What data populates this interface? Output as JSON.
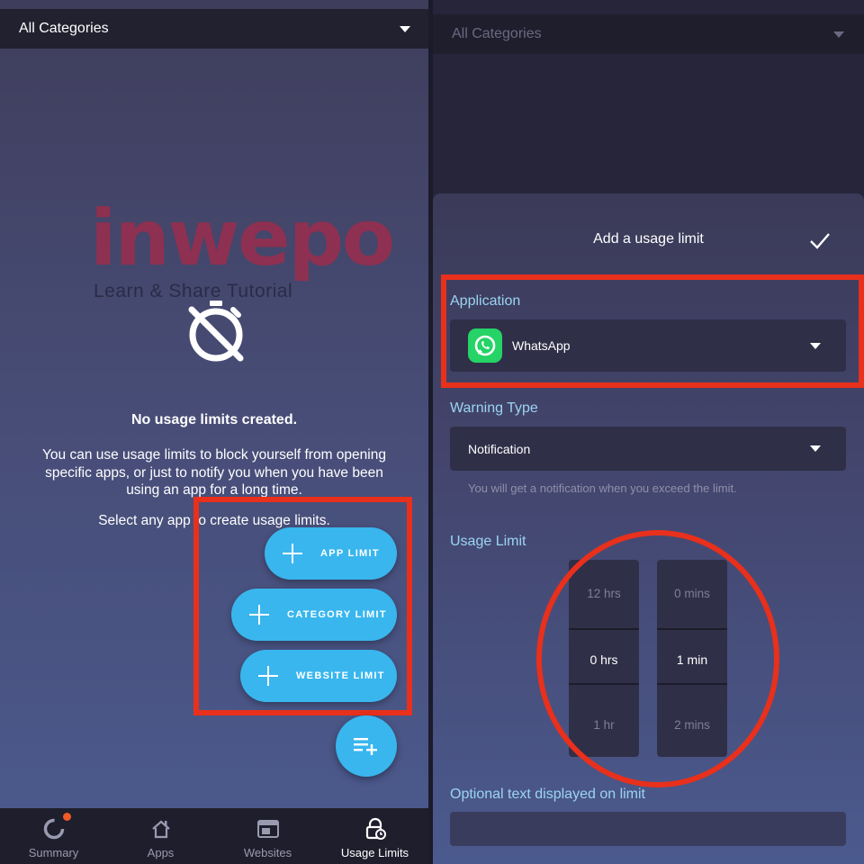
{
  "left": {
    "category_select": "All Categories",
    "watermark": {
      "main": "inwepo",
      "sub": "Learn & Share Tutorial"
    },
    "empty_state": {
      "title": "No usage limits created.",
      "body": "You can use usage limits to block yourself from opening specific apps, or just to notify you when you have been using an app for a long time.",
      "hint": "Select any app to create usage limits."
    },
    "actions": [
      {
        "label": "APP LIMIT"
      },
      {
        "label": "CATEGORY LIMIT"
      },
      {
        "label": "WEBSITE LIMIT"
      }
    ],
    "fab_icon": "playlist-add-icon",
    "bottom_nav": [
      {
        "label": "Summary",
        "icon": "donut-chart-icon",
        "has_notification": true
      },
      {
        "label": "Apps",
        "icon": "home-icon"
      },
      {
        "label": "Websites",
        "icon": "browser-window-icon"
      },
      {
        "label": "Usage Limits",
        "icon": "lock-clock-icon",
        "active": true
      }
    ]
  },
  "right": {
    "category_select": "All Categories",
    "dialog": {
      "title": "Add a usage limit",
      "application": {
        "label": "Application",
        "value": "WhatsApp"
      },
      "warning_type": {
        "label": "Warning Type",
        "value": "Notification",
        "helper": "You will get a notification when you exceed the limit."
      },
      "usage_limit": {
        "label": "Usage Limit",
        "hours": {
          "above": "12 hrs",
          "selected": "0 hrs",
          "below": "1 hr"
        },
        "minutes": {
          "above": "0 mins",
          "selected": "1 min",
          "below": "2 mins"
        }
      },
      "optional_text": {
        "label": "Optional text displayed on limit",
        "value": ""
      }
    }
  },
  "colors": {
    "accent": "#39b6ee",
    "annotation_red": "#e8301c",
    "label_blue": "#9bd4f2",
    "whatsapp_green": "#25d366",
    "notification_dot": "#f05a28"
  }
}
